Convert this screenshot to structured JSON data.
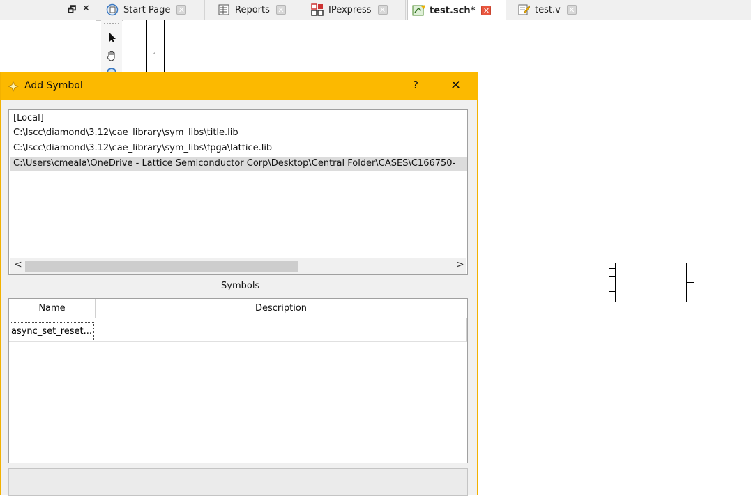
{
  "panel": {
    "float_icon": "float-window-icon",
    "close_glyph": "✕"
  },
  "tabs": [
    {
      "label": "Start Page",
      "icon": "start-page-icon",
      "active": false
    },
    {
      "label": "Reports",
      "icon": "reports-icon",
      "active": false
    },
    {
      "label": "IPexpress",
      "icon": "ipexpress-icon",
      "active": false
    },
    {
      "label": "test.sch*",
      "icon": "schematic-icon",
      "active": true
    },
    {
      "label": "test.v",
      "icon": "verilog-file-icon",
      "active": false
    }
  ],
  "tools": [
    "select-arrow-icon",
    "pan-hand-icon",
    "zoom-icon"
  ],
  "dialog": {
    "title": "Add Symbol",
    "help_label": "?",
    "close_label": "✕",
    "libraries": [
      "[Local]",
      "C:\\lscc\\diamond\\3.12\\cae_library\\sym_libs\\title.lib",
      "C:\\lscc\\diamond\\3.12\\cae_library\\sym_libs\\fpga\\lattice.lib",
      "C:\\Users\\cmeala\\OneDrive - Lattice Semiconductor Corp\\Desktop\\Central Folder\\CASES\\C166750-"
    ],
    "selected_library_index": 3,
    "scroll_left": "<",
    "scroll_right": ">",
    "symbols_label": "Symbols",
    "columns": {
      "name": "Name",
      "description": "Description"
    },
    "rows": [
      {
        "name": "async_set_reset...",
        "description": ""
      }
    ]
  },
  "colors": {
    "dialog_accent": "#fcb900",
    "active_close": "#e9573f"
  }
}
